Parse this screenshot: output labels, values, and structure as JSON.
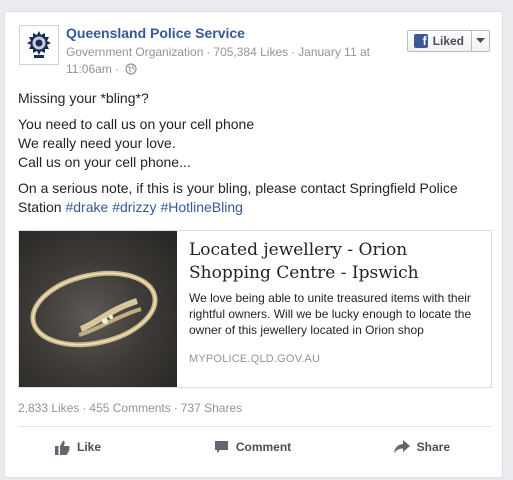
{
  "post": {
    "page_name": "Queensland Police Service",
    "category": "Government Organization",
    "likes": "705,384 Likes",
    "date": "January 11 at 11:06am",
    "liked_label": "Liked",
    "body": {
      "line1": "Missing your *bling*?",
      "line2": "You need to call us on your cell phone",
      "line3": "We really need your love.",
      "line4": "Call us on your cell phone...",
      "line5": "On a serious note, if this is your bling, please contact Springfield Police Station",
      "hashtags": [
        "#drake",
        "#drizzy",
        "#HotlineBling"
      ]
    },
    "link": {
      "title": "Located jewellery - Orion Shopping Centre - Ipswich",
      "description": "We love being able to unite treasured items with their rightful owners. Will we be lucky enough to locate the owner of this jewellery located in Orion shop",
      "domain": "MYPOLICE.QLD.GOV.AU"
    },
    "stats": {
      "likes": "2,833 Likes",
      "comments": "455 Comments",
      "shares": "737 Shares"
    },
    "actions": {
      "like": "Like",
      "comment": "Comment",
      "share": "Share"
    }
  },
  "icons": {
    "avatar": "police-badge-icon",
    "privacy": "globe-icon",
    "liked": "facebook-icon",
    "menu": "chevron-down-icon",
    "like": "thumbs-up-icon",
    "comment": "comment-icon",
    "share": "share-arrow-icon"
  },
  "colors": {
    "link_blue": "#365899",
    "secondary_text": "#90949c",
    "brand": "#3b5998"
  }
}
